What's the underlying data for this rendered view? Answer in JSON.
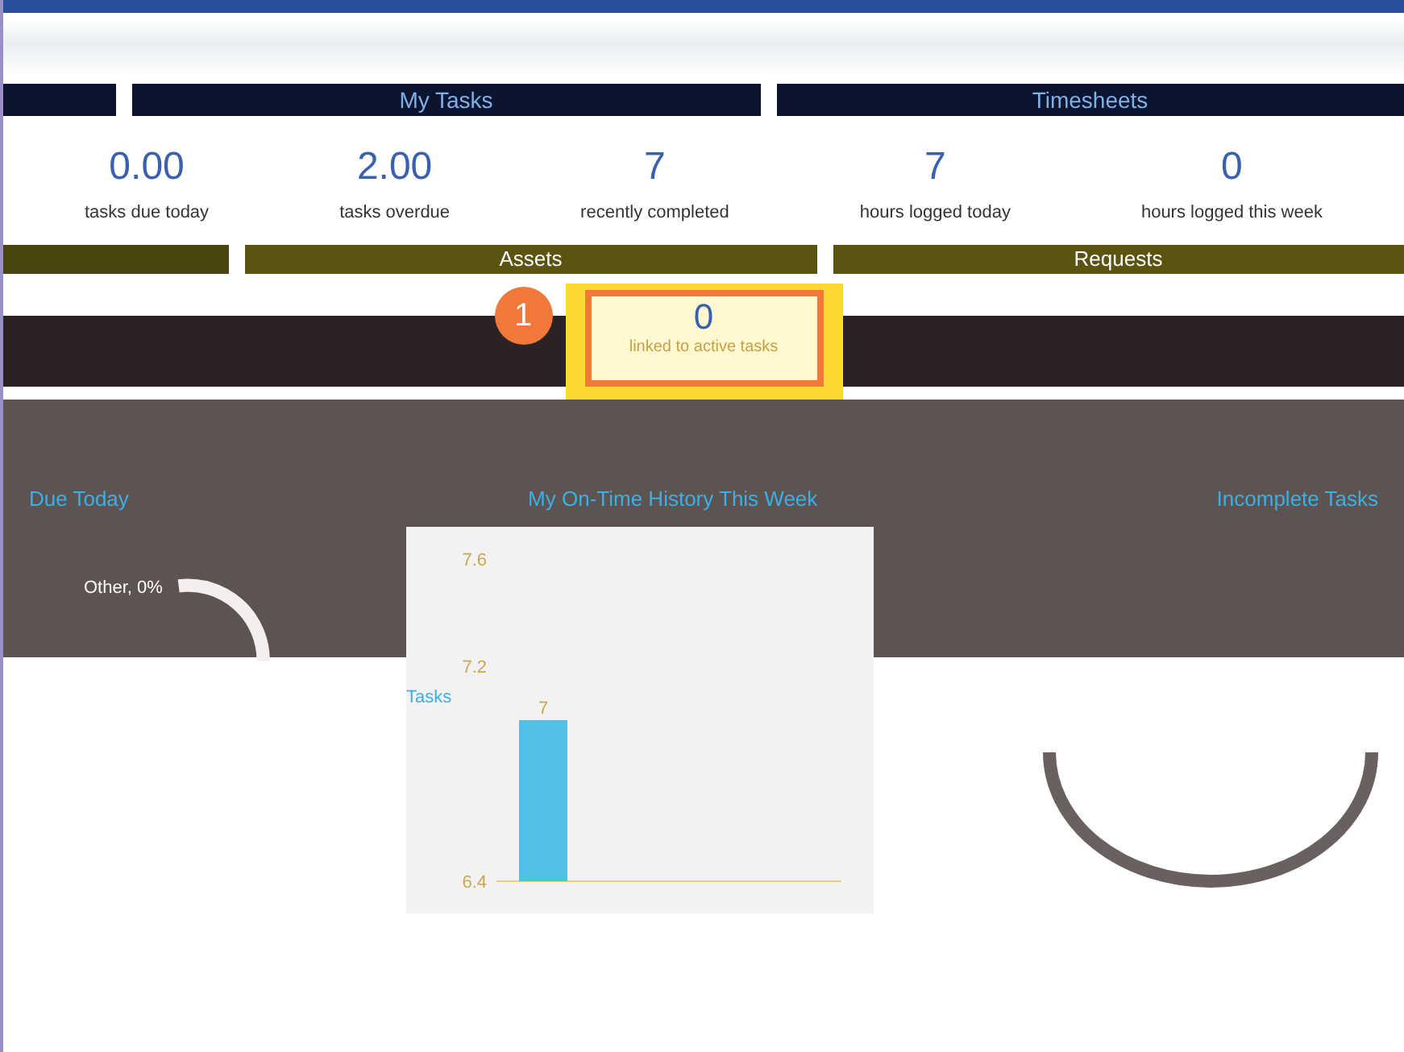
{
  "tabs": [
    {
      "label": "My Tasks",
      "selected": false
    },
    {
      "label": "Timesheets",
      "selected": false
    }
  ],
  "stats": [
    {
      "value": "0.00",
      "label": "tasks due today"
    },
    {
      "value": "2.00",
      "label": "tasks overdue"
    },
    {
      "value": "7",
      "label": "recently completed"
    },
    {
      "value": "7",
      "label": "hours logged today"
    },
    {
      "value": "0",
      "label": "hours logged this week"
    }
  ],
  "sections": [
    {
      "label": "Assets"
    },
    {
      "label": "Requests"
    }
  ],
  "popup": {
    "step": "1",
    "value": "0",
    "label": "linked to active tasks"
  },
  "panels": [
    {
      "title": "Due Today"
    },
    {
      "title": "My On-Time History This Week"
    },
    {
      "title": "Incomplete Tasks"
    }
  ],
  "donut": {
    "label": "Other, 0%"
  },
  "chart_data": {
    "type": "bar",
    "ylabel": "Tasks",
    "values": [
      7
    ],
    "ylim": [
      6.4,
      7.6
    ],
    "yticks": [
      6.4,
      7.2,
      7.6
    ],
    "data_labels": true
  }
}
